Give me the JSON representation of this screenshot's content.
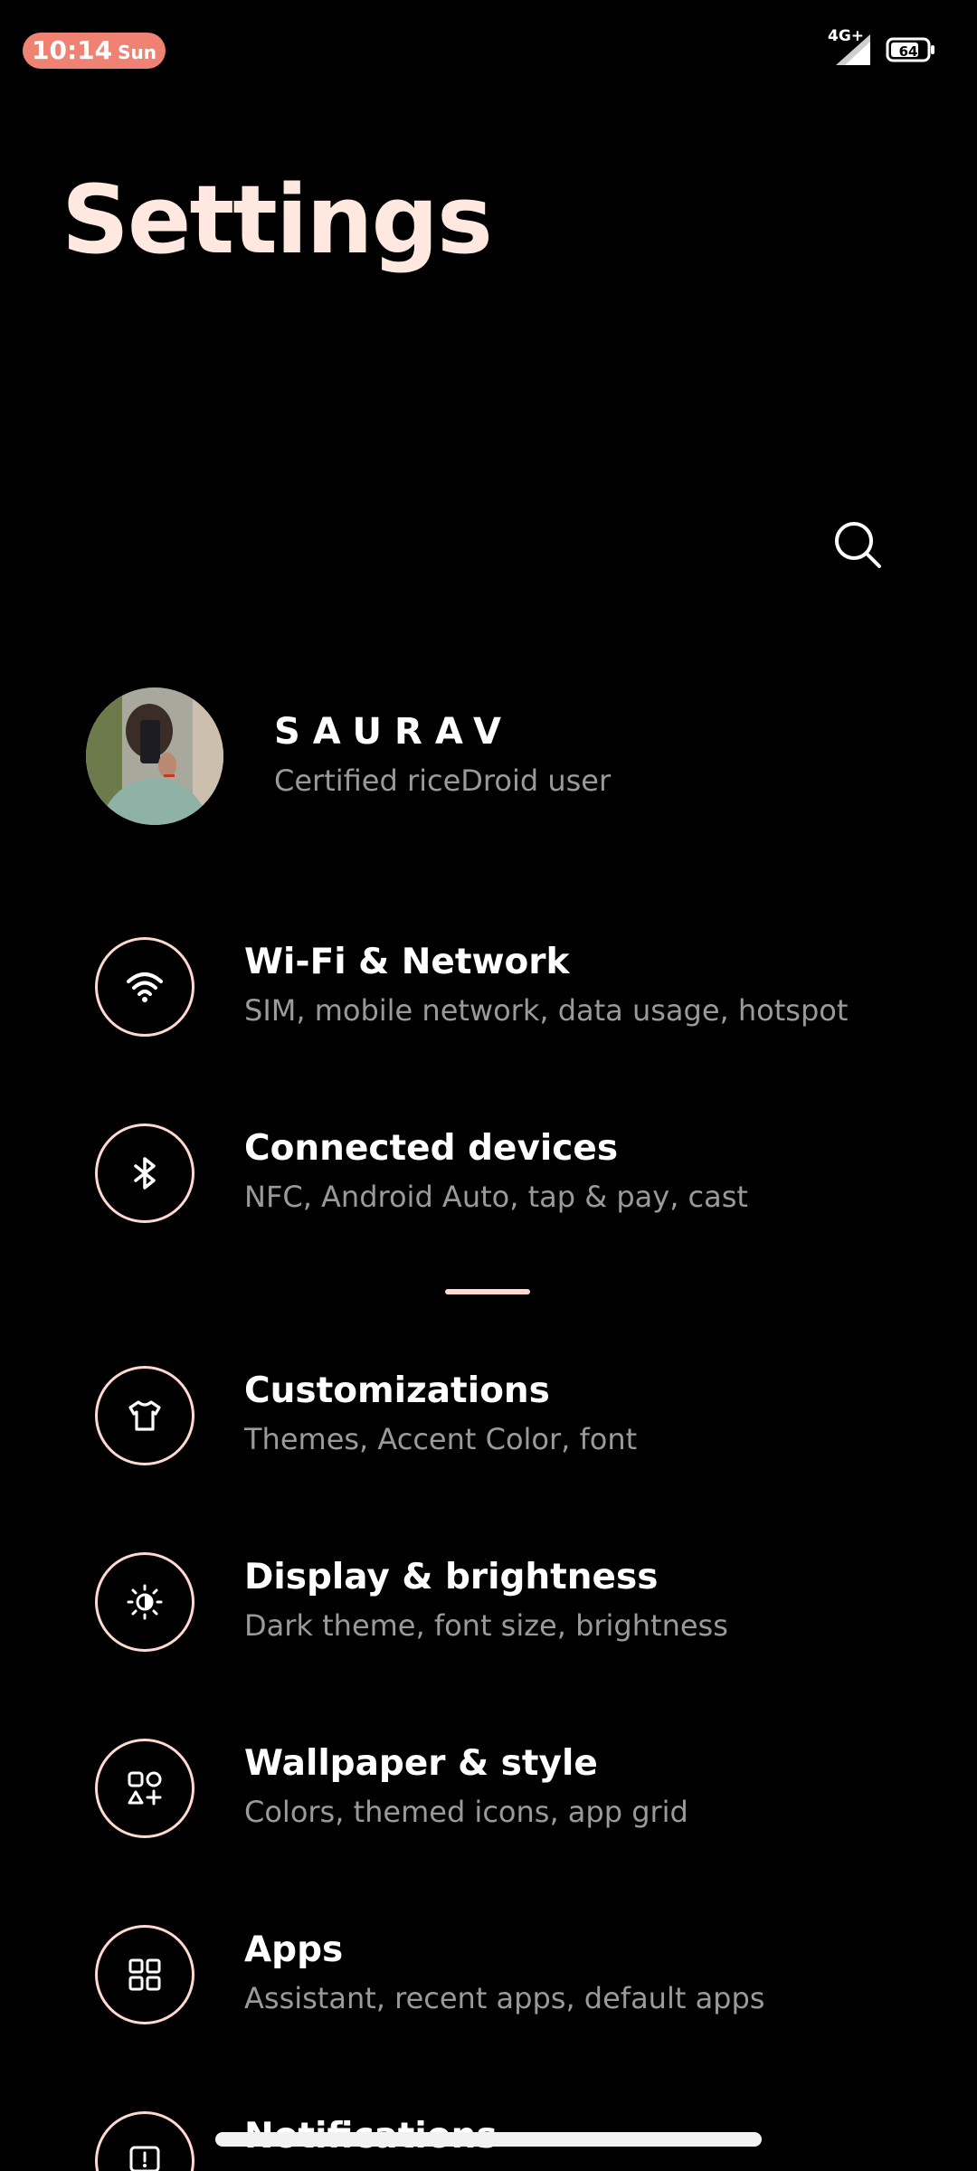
{
  "status_bar": {
    "time": "10:14",
    "day": "Sun",
    "network": "4G+",
    "battery": "64"
  },
  "title": "Settings",
  "search": {
    "icon": "search-icon"
  },
  "profile": {
    "name": "SAURAV",
    "subtitle": "Certified riceDroid user"
  },
  "items": [
    {
      "title": "Wi-Fi & Network",
      "subtitle": "SIM, mobile network, data usage, hotspot",
      "icon": "wifi-icon"
    },
    {
      "title": "Connected devices",
      "subtitle": "NFC, Android Auto, tap & pay, cast",
      "icon": "bluetooth-icon"
    },
    {
      "title": "Customizations",
      "subtitle": "Themes, Accent Color, font",
      "icon": "tshirt-icon"
    },
    {
      "title": "Display & brightness",
      "subtitle": "Dark theme, font size, brightness",
      "icon": "brightness-icon"
    },
    {
      "title": "Wallpaper & style",
      "subtitle": "Colors, themed icons, app grid",
      "icon": "shapes-icon"
    },
    {
      "title": "Apps",
      "subtitle": "Assistant, recent apps, default apps",
      "icon": "apps-grid-icon"
    },
    {
      "title": "Notifications",
      "subtitle": "",
      "icon": "notification-icon"
    }
  ],
  "colors": {
    "background": "#000000",
    "accent": "#ffd9d0",
    "clock_pill": "#f08273",
    "title": "#ffe8e0",
    "secondary_text": "#9a9a9a"
  }
}
